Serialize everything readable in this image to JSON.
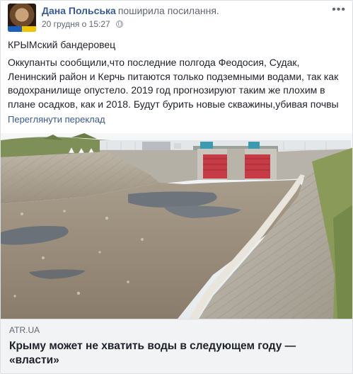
{
  "post": {
    "author": "Дана Польська",
    "action": "поширила посилання.",
    "timestamp": "20 грудня о 15:27",
    "privacy_icon": "globe-icon",
    "menu_icon": "more-icon",
    "intro": "КРЫМский бандеровец",
    "body": "Оккупанты сообщили,что последние полгода Феодосия, Судак, Ленинский район и Керчь питаются только подземными водами, так как водохранилище опустело. 2019 год прогнозируют таким же плохим в плане осадков, как и 2018. Будут бурить новые скважины,убивая почвы",
    "translate_label": "Переглянути переклад"
  },
  "link": {
    "domain": "ATR.UA",
    "title": "Крыму может не хватить воды в следующем году — «власти»"
  },
  "colors": {
    "link_blue": "#385898",
    "text": "#1d2129",
    "muted": "#606770",
    "link_box_bg": "#f2f3f5"
  }
}
